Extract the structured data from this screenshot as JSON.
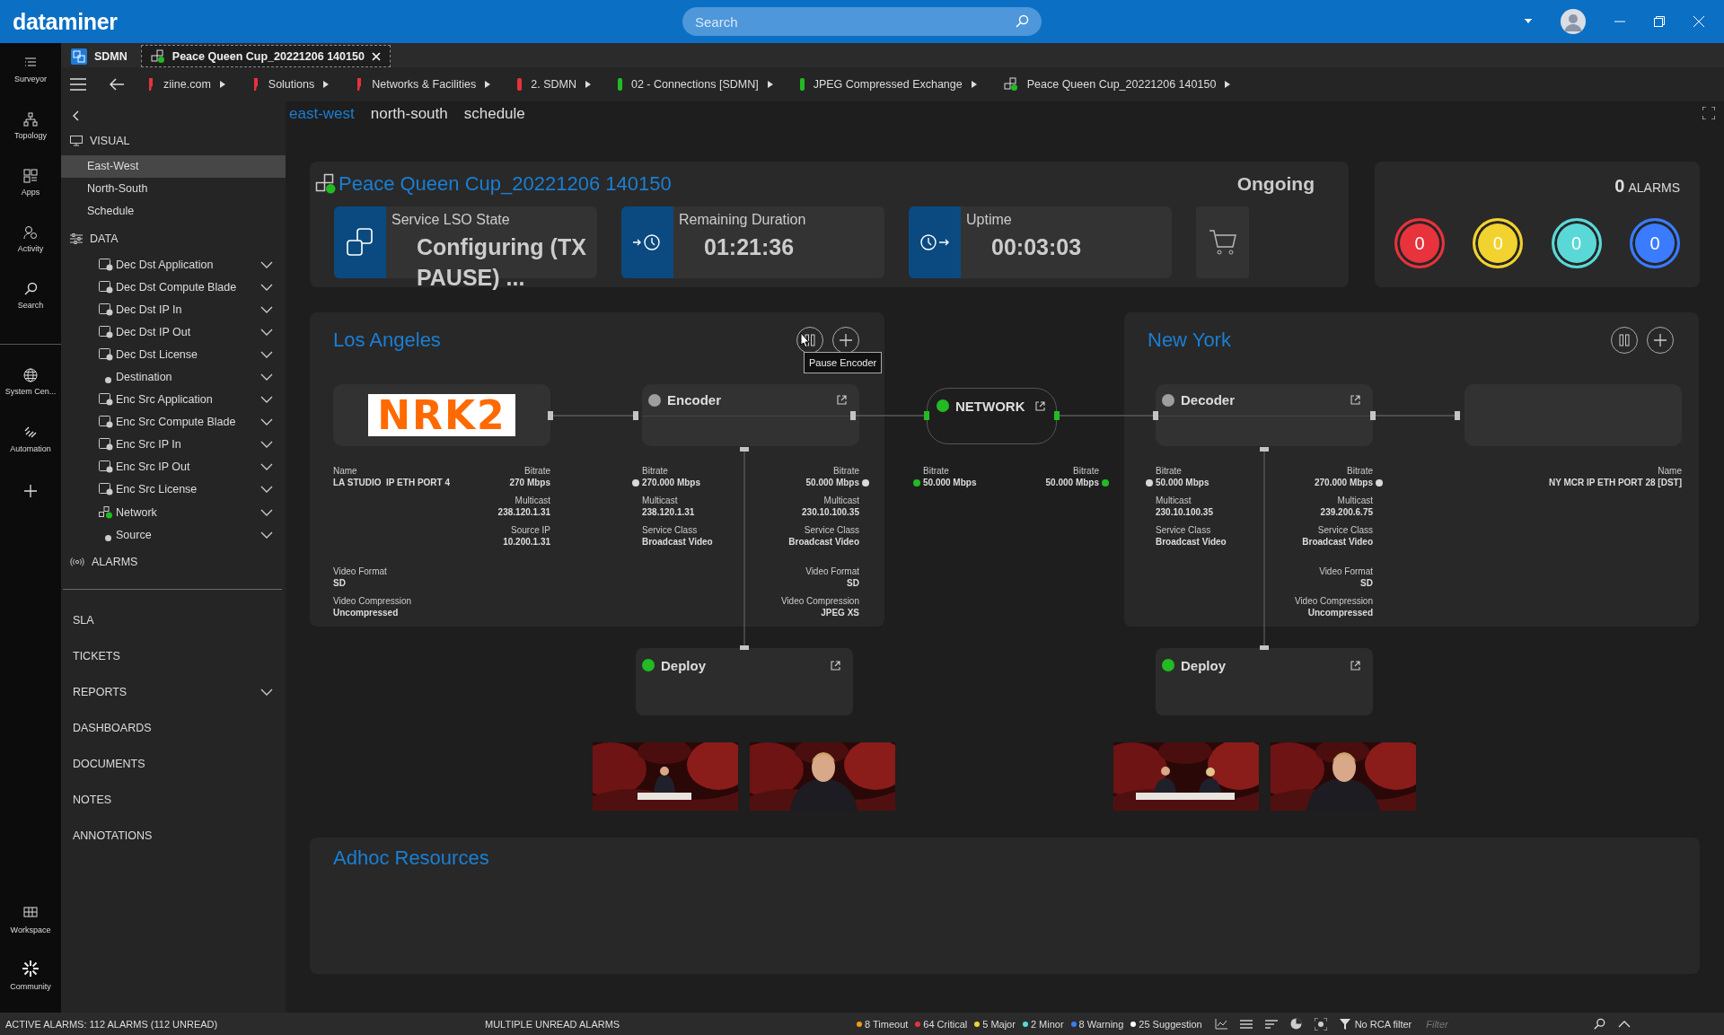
{
  "app": {
    "logo": "dataminer",
    "search": {
      "placeholder": "Search"
    }
  },
  "rail": {
    "items": [
      {
        "label": "Surveyor",
        "kind": "surveyor"
      },
      {
        "label": "Topology",
        "kind": "topology"
      },
      {
        "label": "Apps",
        "kind": "apps"
      },
      {
        "label": "Activity",
        "kind": "activity"
      },
      {
        "label": "Search",
        "kind": "search"
      },
      {
        "label": "System Cen...",
        "kind": "globe"
      },
      {
        "label": "Automation",
        "kind": "automation"
      }
    ],
    "bottom": [
      {
        "label": "Workspace",
        "kind": "workspace"
      },
      {
        "label": "Community",
        "kind": "community"
      }
    ]
  },
  "tabs": [
    {
      "label": "SDMN",
      "selected": false,
      "kind": "app"
    },
    {
      "label": "Peace Queen Cup_20221206 140150",
      "selected": true,
      "kind": "service"
    }
  ],
  "breadcrumbs": [
    {
      "label": "ziine.com",
      "kind": "flag",
      "color": "#e8323c"
    },
    {
      "label": "Solutions",
      "kind": "flag",
      "color": "#e8323c"
    },
    {
      "label": "Networks & Facilities",
      "kind": "flag",
      "color": "#e8323c"
    },
    {
      "label": "2. SDMN",
      "kind": "bar",
      "color": "#e8323c"
    },
    {
      "label": "02 - Connections [SDMN]",
      "kind": "bar",
      "color": "#22bb22"
    },
    {
      "label": "JPEG Compressed Exchange",
      "kind": "bar",
      "color": "#22bb22"
    },
    {
      "label": "Peace Queen Cup_20221206 140150",
      "kind": "service",
      "color": "#22bb22"
    }
  ],
  "sidebar": {
    "sections": [
      {
        "title": "VISUAL",
        "kind": "visual",
        "items": [
          {
            "label": "East-West",
            "selected": true
          },
          {
            "label": "North-South",
            "selected": false
          },
          {
            "label": "Schedule",
            "selected": false
          }
        ]
      },
      {
        "title": "DATA",
        "kind": "data",
        "items": [
          {
            "label": "Dec Dst Application",
            "kind": "resource"
          },
          {
            "label": "Dec Dst Compute Blade",
            "kind": "resource"
          },
          {
            "label": "Dec Dst IP In",
            "kind": "resource"
          },
          {
            "label": "Dec Dst IP Out",
            "kind": "resource"
          },
          {
            "label": "Dec Dst License",
            "kind": "resource"
          },
          {
            "label": "Destination",
            "kind": "dot"
          },
          {
            "label": "Enc Src Application",
            "kind": "resource"
          },
          {
            "label": "Enc Src Compute Blade",
            "kind": "resource"
          },
          {
            "label": "Enc Src IP In",
            "kind": "resource"
          },
          {
            "label": "Enc Src IP Out",
            "kind": "resource"
          },
          {
            "label": "Enc Src License",
            "kind": "resource"
          },
          {
            "label": "Network",
            "kind": "network"
          },
          {
            "label": "Source",
            "kind": "dot"
          }
        ]
      },
      {
        "title": "ALARMS",
        "kind": "alarms"
      }
    ],
    "bottom": [
      {
        "label": "SLA",
        "expandable": false
      },
      {
        "label": "TICKETS",
        "expandable": false
      },
      {
        "label": "REPORTS",
        "expandable": true
      },
      {
        "label": "DASHBOARDS",
        "expandable": false
      },
      {
        "label": "DOCUMENTS",
        "expandable": false
      },
      {
        "label": "NOTES",
        "expandable": false
      },
      {
        "label": "ANNOTATIONS",
        "expandable": false
      }
    ]
  },
  "views": [
    {
      "label": "east-west",
      "selected": true
    },
    {
      "label": "north-south",
      "selected": false
    },
    {
      "label": "schedule",
      "selected": false
    }
  ],
  "service": {
    "title": "Peace Queen Cup_20221206 140150",
    "status": "Ongoing",
    "tiles": [
      {
        "label": "Service LSO State",
        "value": "Configuring (TX PAUSE) ...",
        "kind": "state"
      },
      {
        "label": "Remaining Duration",
        "value": "01:21:36",
        "kind": "remaining"
      },
      {
        "label": "Uptime",
        "value": "00:03:03",
        "kind": "uptime"
      }
    ]
  },
  "alarms": {
    "count": "0",
    "label": "ALARMS",
    "severities": [
      {
        "count": "0",
        "color": "#e8323c"
      },
      {
        "count": "0",
        "color": "#f2d22e"
      },
      {
        "count": "0",
        "color": "#5ad8d8"
      },
      {
        "count": "0",
        "color": "#3a7bff"
      }
    ]
  },
  "sites": [
    {
      "name": "Los Angeles",
      "tooltip": "Pause Encoder",
      "endpoint": {
        "logo": "NRK2",
        "left": [
          {
            "label": "Name",
            "value": "LA STUDIO  IP ETH PORT 4"
          }
        ],
        "right": [
          {
            "label": "Bitrate",
            "value": "270 Mbps"
          },
          {
            "label": "Multicast",
            "value": "238.120.1.31"
          },
          {
            "label": "Source IP",
            "value": "10.200.1.31"
          }
        ],
        "left_format": [
          {
            "label": "Video Format",
            "value": "SD"
          },
          {
            "label": "Video Compression",
            "value": "Uncompressed"
          }
        ]
      },
      "device": {
        "name": "Encoder",
        "active": false,
        "left": [
          {
            "label": "Bitrate",
            "value": "270.000 Mbps",
            "color": "#d9d9d9"
          },
          {
            "label": "Multicast",
            "value": "238.120.1.31"
          },
          {
            "label": "Service Class",
            "value": "Broadcast Video"
          }
        ],
        "right": [
          {
            "label": "Bitrate",
            "value": "50.000 Mbps",
            "color": "#d9d9d9"
          },
          {
            "label": "Multicast",
            "value": "230.10.100.35"
          },
          {
            "label": "Service Class",
            "value": "Broadcast Video"
          }
        ],
        "right_format": [
          {
            "label": "Video Format",
            "value": "SD"
          },
          {
            "label": "Video Compression",
            "value": "JPEG XS"
          }
        ]
      },
      "deploy": {
        "name": "Deploy",
        "active": true
      }
    },
    {
      "name": "New York",
      "endpoint": {
        "right": [
          {
            "label": "Name",
            "value": "NY MCR IP ETH PORT 28 [DST]"
          }
        ]
      },
      "device": {
        "name": "Decoder",
        "active": false,
        "left": [
          {
            "label": "Bitrate",
            "value": "50.000 Mbps",
            "color": "#d9d9d9"
          },
          {
            "label": "Multicast",
            "value": "230.10.100.35"
          },
          {
            "label": "Service Class",
            "value": "Broadcast Video"
          }
        ],
        "right": [
          {
            "label": "Bitrate",
            "value": "270.000 Mbps",
            "color": "#d9d9d9"
          },
          {
            "label": "Multicast",
            "value": "239.200.6.75"
          },
          {
            "label": "Service Class",
            "value": "Broadcast Video"
          }
        ],
        "right_format": [
          {
            "label": "Video Format",
            "value": "SD"
          },
          {
            "label": "Video Compression",
            "value": "Uncompressed"
          }
        ]
      },
      "deploy": {
        "name": "Deploy",
        "active": true
      }
    }
  ],
  "network": {
    "name": "NETWORK",
    "active": true,
    "left": [
      {
        "label": "Bitrate",
        "value": "50.000 Mbps",
        "color": "#22bb22"
      }
    ],
    "right": [
      {
        "label": "Bitrate",
        "value": "50.000 Mbps",
        "color": "#22bb22"
      }
    ]
  },
  "adhoc": {
    "title": "Adhoc Resources"
  },
  "status_bar": {
    "summary": "ACTIVE ALARMS: 112 ALARMS (112 UNREAD)",
    "notice": "MULTIPLE UNREAD ALARMS",
    "counters": [
      {
        "label": "8 Timeout",
        "color": "#f39c12"
      },
      {
        "label": "64 Critical",
        "color": "#e8323c"
      },
      {
        "label": "5 Major",
        "color": "#f2d22e"
      },
      {
        "label": "2 Minor",
        "color": "#5ad8d8"
      },
      {
        "label": "8 Warning",
        "color": "#3a7bff"
      },
      {
        "label": "25 Suggestion",
        "color": "#ffffff"
      }
    ],
    "rca_filter": "No RCA filter",
    "filter": {
      "placeholder": "Filter"
    }
  }
}
